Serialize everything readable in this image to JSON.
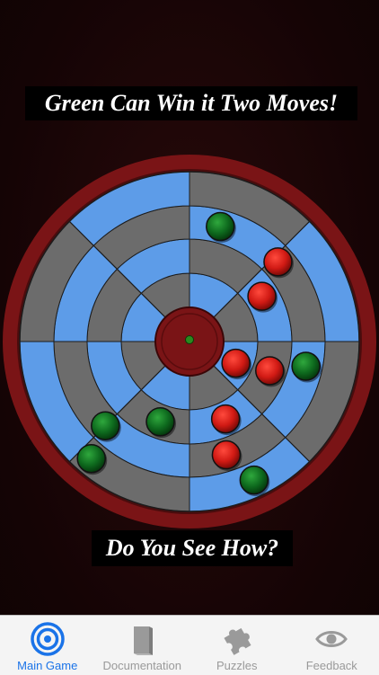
{
  "headline": "Green Can Win it Two Moves!",
  "subline": "Do You See How?",
  "colors": {
    "rim": "#7a1416",
    "ring_blue": "#5d9ce8",
    "ring_gray": "#6c6c6c",
    "hub": "#7a1416",
    "green_piece": "#0e6a1e",
    "red_piece": "#d11a14",
    "tab_active": "#1a73e8",
    "tab_inactive": "#9a9a9a"
  },
  "board": {
    "rings": 4,
    "sectors": 8,
    "pieces": [
      {
        "color": "green",
        "ring": 2,
        "angle": 200
      },
      {
        "color": "red",
        "ring": 2,
        "angle": 155
      },
      {
        "color": "red",
        "ring": 3,
        "angle": 162
      },
      {
        "color": "green",
        "ring": 4,
        "angle": 155
      },
      {
        "color": "red",
        "ring": 1,
        "angle": 115
      },
      {
        "color": "red",
        "ring": 2,
        "angle": 110
      },
      {
        "color": "red",
        "ring": 3,
        "angle": 48
      },
      {
        "color": "red",
        "ring": 2,
        "angle": 58
      },
      {
        "color": "green",
        "ring": 3,
        "angle": 15
      },
      {
        "color": "green",
        "ring": 3,
        "angle": 102
      },
      {
        "color": "green",
        "ring": 3,
        "angle": 225
      },
      {
        "color": "green",
        "ring": 4,
        "angle": 220
      }
    ]
  },
  "tabs": [
    {
      "label": "Main Game",
      "icon": "target-icon",
      "active": true
    },
    {
      "label": "Documentation",
      "icon": "book-icon",
      "active": false
    },
    {
      "label": "Puzzles",
      "icon": "puzzle-icon",
      "active": false
    },
    {
      "label": "Feedback",
      "icon": "eye-icon",
      "active": false
    }
  ]
}
